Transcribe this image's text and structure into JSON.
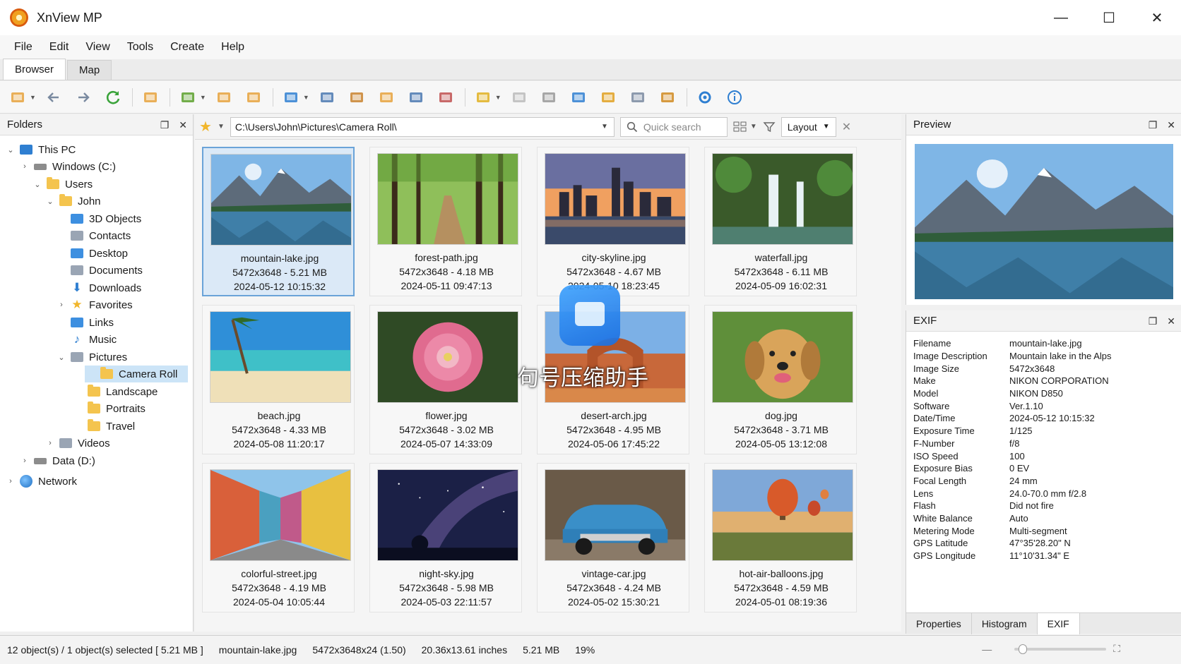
{
  "app": {
    "title": "XnView MP"
  },
  "window_controls": {
    "minimize": "—",
    "maximize": "☐",
    "close": "✕"
  },
  "menu": [
    "File",
    "Edit",
    "View",
    "Tools",
    "Create",
    "Help"
  ],
  "tabs": [
    {
      "label": "Browser",
      "active": true
    },
    {
      "label": "Map",
      "active": false
    }
  ],
  "toolbar": {
    "icons": [
      "open-folder-icon",
      "back-icon",
      "forward-icon",
      "refresh-icon",
      "move-to-folder-icon",
      "convert-icon",
      "batch-icon",
      "copy-to-folder-icon",
      "filter-icon",
      "view-icon",
      "compare-icon",
      "slideshow-icon",
      "contact-sheet-icon",
      "panorama-icon",
      "edit-icon",
      "print-icon",
      "settings-icon",
      "plugin-icon",
      "tags-icon",
      "categories-icon",
      "effects-icon",
      "gear-icon",
      "about-icon"
    ]
  },
  "folders": {
    "title": "Folders",
    "tree": [
      {
        "label": "This PC",
        "icon": "pc-icon",
        "expander": "v"
      },
      {
        "label": "Windows (C:)",
        "icon": "drive-icon",
        "expander": ">"
      },
      {
        "label": "Users",
        "icon": "folder-icon",
        "expander": "v"
      },
      {
        "label": "John",
        "icon": "folder-icon",
        "expander": "v"
      },
      {
        "label": "3D Objects",
        "icon": "cube-icon",
        "expander": ""
      },
      {
        "label": "Contacts",
        "icon": "contacts-icon",
        "expander": ""
      },
      {
        "label": "Desktop",
        "icon": "desktop-icon",
        "expander": ""
      },
      {
        "label": "Documents",
        "icon": "documents-icon",
        "expander": ""
      },
      {
        "label": "Downloads",
        "icon": "downloads-icon",
        "expander": ""
      },
      {
        "label": "Favorites",
        "icon": "star-icon",
        "expander": ">"
      },
      {
        "label": "Links",
        "icon": "links-icon",
        "expander": ""
      },
      {
        "label": "Music",
        "icon": "music-icon",
        "expander": ""
      },
      {
        "label": "Pictures",
        "icon": "pictures-icon",
        "expander": "v"
      },
      {
        "label": "Camera Roll",
        "icon": "folder-icon",
        "expander": "",
        "selected": true
      },
      {
        "label": "Landscape",
        "icon": "folder-icon",
        "expander": ""
      },
      {
        "label": "Portraits",
        "icon": "folder-icon",
        "expander": ""
      },
      {
        "label": "Travel",
        "icon": "folder-icon",
        "expander": ""
      },
      {
        "label": "Videos",
        "icon": "videos-icon",
        "expander": ">"
      },
      {
        "label": "Data (D:)",
        "icon": "drive-icon",
        "expander": ">"
      },
      {
        "label": "Network",
        "icon": "network-icon",
        "expander": ">"
      }
    ]
  },
  "address": {
    "path": "C:\\Users\\John\\Pictures\\Camera Roll\\",
    "search_placeholder": "Quick search",
    "layout_label": "Layout"
  },
  "files": [
    {
      "name": "mountain-lake.jpg",
      "info": "5472x3648 - 5.21 MB",
      "date": "2024-05-12 10:15:32",
      "selected": true,
      "scene": "mountain"
    },
    {
      "name": "forest-path.jpg",
      "info": "5472x3648 - 4.18 MB",
      "date": "2024-05-11 09:47:13",
      "scene": "forest"
    },
    {
      "name": "city-skyline.jpg",
      "info": "5472x3648 - 4.67 MB",
      "date": "2024-05-10 18:23:45",
      "scene": "city"
    },
    {
      "name": "waterfall.jpg",
      "info": "5472x3648 - 6.11 MB",
      "date": "2024-05-09 16:02:31",
      "scene": "waterfall"
    },
    {
      "name": "beach.jpg",
      "info": "5472x3648 - 4.33 MB",
      "date": "2024-05-08 11:20:17",
      "scene": "beach"
    },
    {
      "name": "flower.jpg",
      "info": "5472x3648 - 3.02 MB",
      "date": "2024-05-07 14:33:09",
      "scene": "flower"
    },
    {
      "name": "desert-arch.jpg",
      "info": "5472x3648 - 4.95 MB",
      "date": "2024-05-06 17:45:22",
      "scene": "desert"
    },
    {
      "name": "dog.jpg",
      "info": "5472x3648 - 3.71 MB",
      "date": "2024-05-05 13:12:08",
      "scene": "dog"
    },
    {
      "name": "colorful-street.jpg",
      "info": "5472x3648 - 4.19 MB",
      "date": "2024-05-04 10:05:44",
      "scene": "street"
    },
    {
      "name": "night-sky.jpg",
      "info": "5472x3648 - 5.98 MB",
      "date": "2024-05-03 22:11:57",
      "scene": "night"
    },
    {
      "name": "vintage-car.jpg",
      "info": "5472x3648 - 4.24 MB",
      "date": "2024-05-02 15:30:21",
      "scene": "car"
    },
    {
      "name": "hot-air-balloons.jpg",
      "info": "5472x3648 - 4.59 MB",
      "date": "2024-05-01 08:19:36",
      "scene": "balloons"
    }
  ],
  "preview": {
    "title": "Preview"
  },
  "exif": {
    "title": "EXIF",
    "rows": [
      {
        "key": "Filename",
        "value": "mountain-lake.jpg"
      },
      {
        "key": "Image Description",
        "value": "Mountain lake in the Alps"
      },
      {
        "key": "Image Size",
        "value": "5472x3648"
      },
      {
        "key": "Make",
        "value": "NIKON CORPORATION"
      },
      {
        "key": "Model",
        "value": "NIKON D850"
      },
      {
        "key": "Software",
        "value": "Ver.1.10"
      },
      {
        "key": "Date/Time",
        "value": "2024-05-12 10:15:32"
      },
      {
        "key": "Exposure Time",
        "value": "1/125"
      },
      {
        "key": "F-Number",
        "value": "f/8"
      },
      {
        "key": "ISO Speed",
        "value": "100"
      },
      {
        "key": "Exposure Bias",
        "value": "0 EV"
      },
      {
        "key": "Focal Length",
        "value": "24 mm"
      },
      {
        "key": "Lens",
        "value": "24.0-70.0 mm f/2.8"
      },
      {
        "key": "Flash",
        "value": "Did not fire"
      },
      {
        "key": "White Balance",
        "value": "Auto"
      },
      {
        "key": "Metering Mode",
        "value": "Multi-segment"
      },
      {
        "key": "GPS Latitude",
        "value": "47°35'28.20\" N"
      },
      {
        "key": "GPS Longitude",
        "value": "11°10'31.34\" E"
      }
    ],
    "tabs": [
      {
        "label": "Properties"
      },
      {
        "label": "Histogram"
      },
      {
        "label": "EXIF",
        "active": true
      }
    ]
  },
  "status": {
    "selection": "12 object(s) / 1 object(s) selected [ 5.21 MB ]",
    "filename": "mountain-lake.jpg",
    "dimensions": "5472x3648x24 (1.50)",
    "print_size": "20.36x13.61 inches",
    "filesize": "5.21 MB",
    "zoom": "19%",
    "zoom_slider_fraction": 0.05
  },
  "watermark": {
    "text": "句号压缩助手"
  },
  "colors": {
    "selection": "#cce4f7",
    "selected_thumb_border": "#6aa3d8",
    "accent": "#2f7fd1"
  }
}
